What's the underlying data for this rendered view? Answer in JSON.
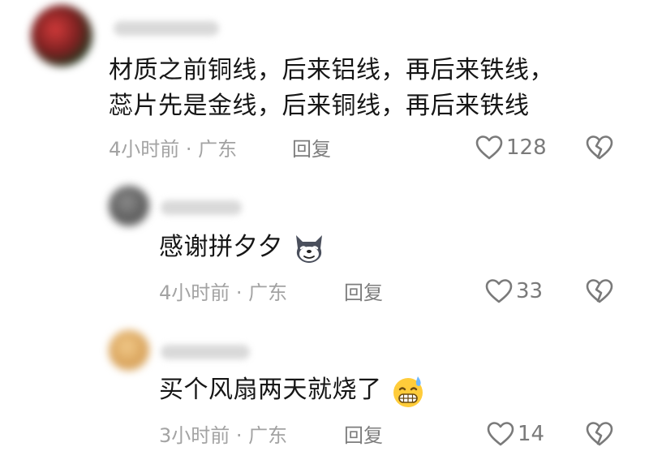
{
  "comments": [
    {
      "text_line1": "材质之前铜线，后来铝线，再后来铁线，",
      "text_line2": "蕊片先是金线，后来铜线，再后来铁线",
      "time": "4小时前 · 广东",
      "reply_label": "回复",
      "likes": "128"
    },
    {
      "text": "感谢拼夕夕",
      "emoji": "husky-dog-emoji",
      "time": "4小时前 · 广东",
      "reply_label": "回复",
      "likes": "33"
    },
    {
      "text": "买个风扇两天就烧了",
      "emoji": "grimace-sweat-emoji",
      "time": "3小时前 · 广东",
      "reply_label": "回复",
      "likes": "14"
    }
  ],
  "icons": {
    "like": "heart-outline-icon",
    "dislike": "broken-heart-icon"
  },
  "colors": {
    "text": "#161616",
    "meta": "#a3a3a3",
    "reply": "#7d7d7d",
    "icon": "#7a7a7a"
  }
}
